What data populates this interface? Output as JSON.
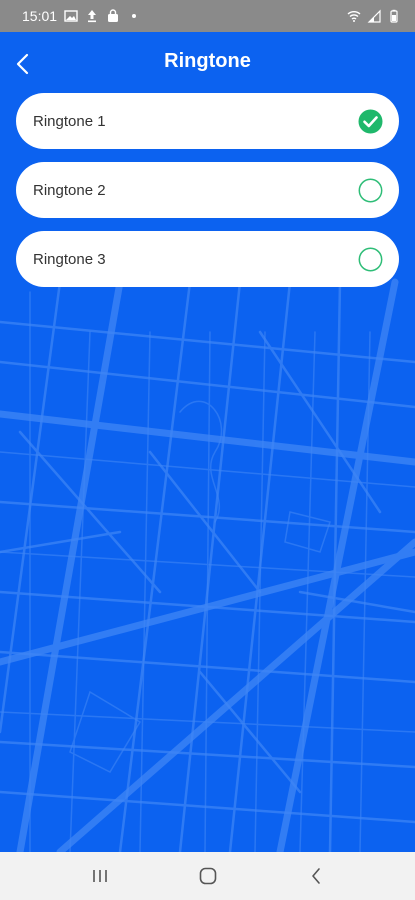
{
  "status_bar": {
    "time": "15:01",
    "left_icons": [
      "gallery-icon",
      "upload-icon",
      "bag-icon",
      "notification-dot-icon"
    ],
    "right_icons": [
      "wifi-icon",
      "signal-icon",
      "battery-icon"
    ]
  },
  "header": {
    "title": "Ringtone",
    "back_icon": "chevron-left-icon"
  },
  "ringtones": [
    {
      "label": "Ringtone 1",
      "selected": true
    },
    {
      "label": "Ringtone 2",
      "selected": false
    },
    {
      "label": "Ringtone 3",
      "selected": false
    }
  ],
  "nav_bar": {
    "buttons": [
      "recent-apps-icon",
      "home-icon",
      "back-icon"
    ]
  },
  "colors": {
    "background": "#0c62f0",
    "map_lines": "#3f86f6",
    "check_green": "#1fb86b",
    "radio_outline": "#2ebd77",
    "item_background": "#ffffff",
    "status_bar": "#8a8a8a",
    "nav_bar": "#f2f2f2"
  }
}
